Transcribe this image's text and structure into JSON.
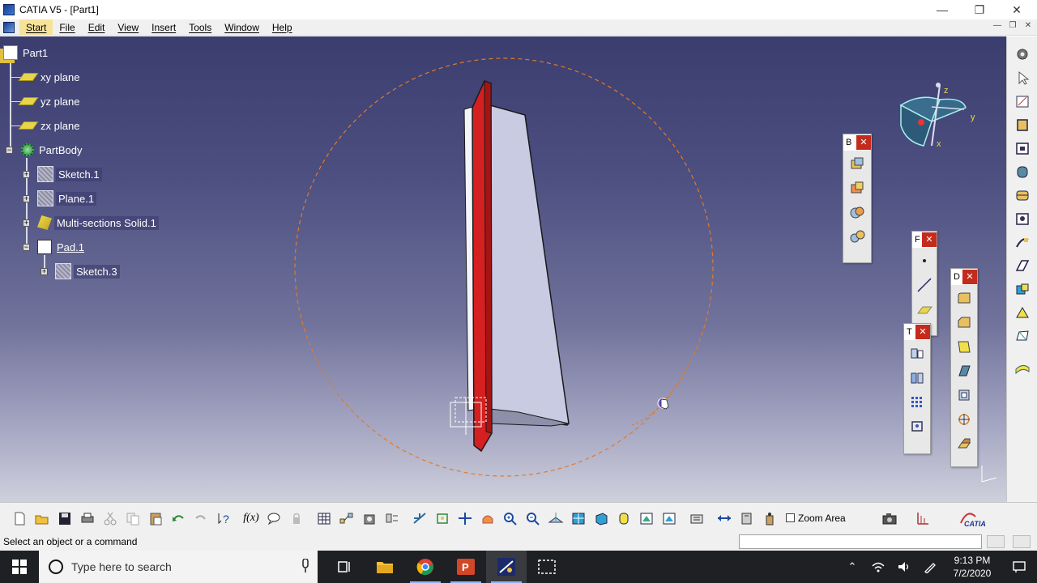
{
  "window": {
    "title": "CATIA V5 - [Part1]"
  },
  "menu": {
    "items": [
      "Start",
      "File",
      "Edit",
      "View",
      "Insert",
      "Tools",
      "Window",
      "Help"
    ]
  },
  "tree": {
    "root": "Part1",
    "xy_plane": "xy plane",
    "yz_plane": "yz plane",
    "zx_plane": "zx plane",
    "part_body": "PartBody",
    "sketch1": "Sketch.1",
    "plane1": "Plane.1",
    "multi_sections_solid": "Multi-sections Solid.1",
    "pad1": "Pad.1",
    "sketch3": "Sketch.3"
  },
  "floating_toolbars": {
    "b_title": "B",
    "f_title": "F",
    "d_title": "D",
    "t_title": "T",
    "close_glyph": "✕"
  },
  "compass": {
    "x_label": "x",
    "y_label": "y",
    "z_label": "z"
  },
  "bottom_toolbar": {
    "zoom_area_label": "Zoom Area",
    "formula_label": "f(x)"
  },
  "status": {
    "text": "Select an object or a command"
  },
  "taskbar": {
    "search_placeholder": "Type here to search",
    "time": "9:13 PM",
    "date": "7/2/2020"
  },
  "colors": {
    "accent_selection": "#f7e29a",
    "pad_red": "#d42020",
    "close_red": "#c42b1c"
  }
}
